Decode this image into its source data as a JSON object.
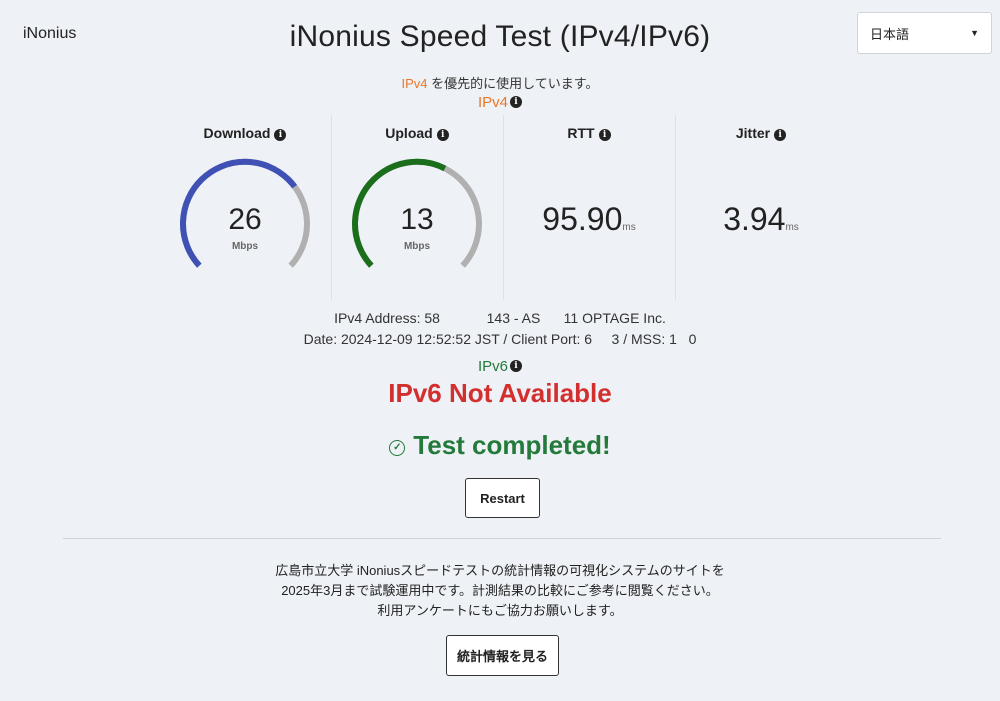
{
  "brand": "iNonius",
  "title": "iNonius Speed Test (IPv4/IPv6)",
  "language": {
    "selected": "日本語"
  },
  "notice": {
    "proto": "IPv4",
    "text": " を優先的に使用しています。"
  },
  "ipv4_label": "IPv4",
  "ipv6_label": "IPv6",
  "metrics": {
    "download": {
      "label": "Download",
      "value": "26",
      "unit": "Mbps",
      "fill": 0.7,
      "color": "#3f51b5"
    },
    "upload": {
      "label": "Upload",
      "value": "13",
      "unit": "Mbps",
      "fill": 0.6,
      "color": "#1b6e1b"
    },
    "rtt": {
      "label": "RTT",
      "value": "95.90",
      "unit": "ms"
    },
    "jitter": {
      "label": "Jitter",
      "value": "3.94",
      "unit": "ms"
    }
  },
  "address_line": "IPv4 Address: 58            143 - AS      11 OPTAGE Inc.",
  "date_line": "Date: 2024-12-09 12:52:52 JST / Client Port: 6     3 / MSS: 1   0",
  "ipv6_status": "IPv6 Not Available",
  "completed": "Test completed!",
  "restart_button": "Restart",
  "footer_lines": [
    "広島市立大学 iNoniusスピードテストの統計情報の可視化システムのサイトを",
    "2025年3月まで試験運用中です。計測結果の比較にご参考に閲覧ください。",
    "利用アンケートにもご協力お願いします。"
  ],
  "stats_button": "統計情報を見る",
  "info_glyph": "i",
  "check_glyph": "✓"
}
